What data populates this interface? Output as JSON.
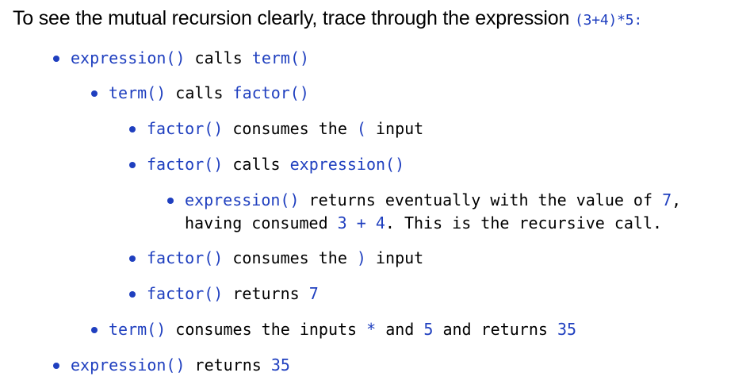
{
  "intro": {
    "text": "To see the mutual recursion clearly, trace through the expression ",
    "code": "(3+4)*5:"
  },
  "items": [
    {
      "parts": [
        {
          "code": "expression()"
        },
        {
          "text": " calls "
        },
        {
          "code": "term()"
        }
      ]
    },
    {
      "parts": [
        {
          "code": "term()"
        },
        {
          "text": " calls "
        },
        {
          "code": "factor()"
        }
      ]
    },
    {
      "parts": [
        {
          "code": "factor()"
        },
        {
          "text": " consumes the "
        },
        {
          "code": "("
        },
        {
          "text": " input"
        }
      ]
    },
    {
      "parts": [
        {
          "code": "factor()"
        },
        {
          "text": " calls "
        },
        {
          "code": "expression()"
        }
      ]
    },
    {
      "parts": [
        {
          "code": "expression()"
        },
        {
          "text": " returns eventually with the value of "
        },
        {
          "code": "7"
        },
        {
          "text": ","
        }
      ]
    },
    {
      "parts": [
        {
          "text": "having consumed "
        },
        {
          "code": "3 + 4"
        },
        {
          "text": ". This is the recursive call."
        }
      ]
    },
    {
      "parts": [
        {
          "code": "factor()"
        },
        {
          "text": " consumes the "
        },
        {
          "code": ")"
        },
        {
          "text": " input"
        }
      ]
    },
    {
      "parts": [
        {
          "code": "factor()"
        },
        {
          "text": " returns "
        },
        {
          "code": "7"
        }
      ]
    },
    {
      "parts": [
        {
          "code": "term()"
        },
        {
          "text": " consumes the inputs "
        },
        {
          "code": "*"
        },
        {
          "text": " and "
        },
        {
          "code": "5"
        },
        {
          "text": " and returns "
        },
        {
          "code": "35"
        }
      ]
    },
    {
      "parts": [
        {
          "code": "expression()"
        },
        {
          "text": " returns "
        },
        {
          "code": "35"
        }
      ]
    }
  ],
  "colors": {
    "code": "#1f3fbf",
    "text": "#000000",
    "bullet": "#1f3fbf"
  }
}
